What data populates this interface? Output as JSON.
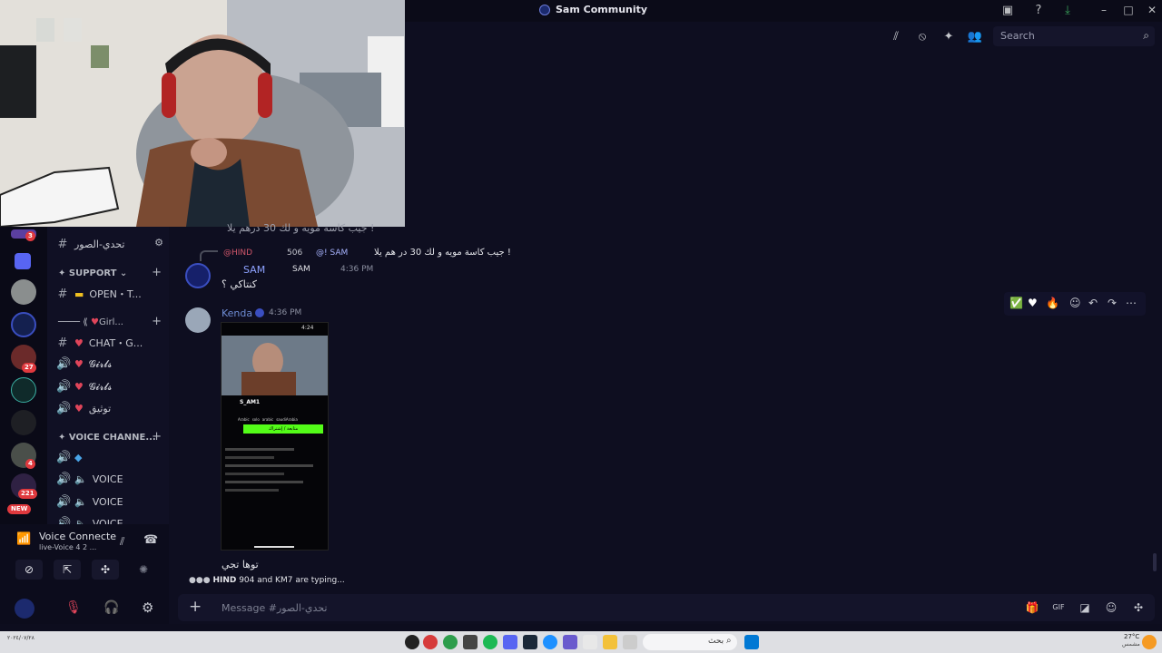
{
  "window": {
    "title": "Sam Community"
  },
  "header": {
    "search_placeholder": "Search"
  },
  "rail": {
    "badges": [
      "3",
      "27",
      "4",
      "221"
    ],
    "new_label": "NEW"
  },
  "channels": {
    "current": "تحدي-الصور",
    "support_category": "SUPPORT",
    "open_channel": "OPEN・T...",
    "girls_category": "Girl...",
    "chat_channel": "CHAT・G...",
    "girls_voice_1": "𝓖𝓲𝓻𝓵𝓼",
    "girls_voice_2": "𝓖𝓲𝓻𝓵𝓼",
    "tawtheeq": "توثيق",
    "voice_category": "VOICE CHANNE...",
    "voice_1": "VOICE",
    "voice_2": "VOICE",
    "voice_3": "VOICE"
  },
  "voice_panel": {
    "title": "Voice Connecte",
    "subtitle": "live-Voice 4 2 ..."
  },
  "messages": {
    "prev_cut": "جيب كاسة مويه و لك 30 درهم يلا !",
    "reply_name": "@HIND",
    "reply_tag": "506",
    "reply_mention": "@!  SAM",
    "reply_text": "جيب كاسة مويه و لك 30 در هم يلا !",
    "sam_name": "SAM",
    "sam_tag": "SAM",
    "sam_time": "4:36 PM",
    "sam_text": "كنتاكي ؟",
    "kenda_name": "Kenda",
    "kenda_time": "4:36 PM",
    "kenda_text": "توها تجي",
    "typing_names": "HIND",
    "typing_tag": "904",
    "typing_rest": "and KM7 are typing..."
  },
  "attachment": {
    "time": "4:24",
    "user": "S_AM1",
    "tags": [
      "Arabic",
      "solo",
      "arabic",
      "saudiArabia"
    ],
    "follow_label": "متابعة / إشتراك"
  },
  "composer": {
    "placeholder": "Message #تحدي-الصور"
  },
  "taskbar": {
    "search_label": "بحث",
    "weather": "27°C",
    "weather_sub": "مشمس",
    "clock_date": "٢٠٢٤/٠٧/٢٨"
  },
  "colors": {
    "accent": "#5865f2",
    "kenda": "#6e8cd4",
    "sam": "#8ea2ff",
    "green": "#3ba55c"
  }
}
